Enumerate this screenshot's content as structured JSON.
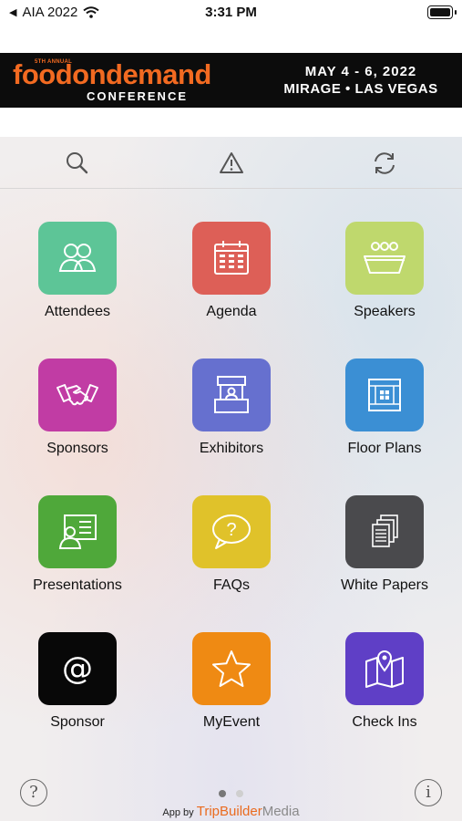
{
  "status_bar": {
    "carrier": "AIA 2022",
    "time": "3:31 PM",
    "back_glyph": "◀"
  },
  "banner": {
    "annual": "5TH ANNUAL",
    "title": "foodondemand",
    "subtitle": "CONFERENCE",
    "dates": "MAY 4 - 6, 2022",
    "location": "MIRAGE  •  LAS VEGAS",
    "accent": "#f26a21"
  },
  "toolbar": {
    "search_icon": "search-icon",
    "alert_icon": "alert-icon",
    "refresh_icon": "refresh-icon"
  },
  "tiles": [
    {
      "label": "Attendees",
      "color": "#5dc597",
      "icon": "attendees-icon"
    },
    {
      "label": "Agenda",
      "color": "#dd5f57",
      "icon": "calendar-icon"
    },
    {
      "label": "Speakers",
      "color": "#bfd86d",
      "icon": "speakers-icon"
    },
    {
      "label": "Sponsors",
      "color": "#c13ca4",
      "icon": "handshake-icon"
    },
    {
      "label": "Exhibitors",
      "color": "#6670cf",
      "icon": "booth-icon"
    },
    {
      "label": "Floor Plans",
      "color": "#3b8fd4",
      "icon": "floorplan-icon"
    },
    {
      "label": "Presentations",
      "color": "#4fa83a",
      "icon": "presentation-icon"
    },
    {
      "label": "FAQs",
      "color": "#e0c22a",
      "icon": "question-bubble-icon"
    },
    {
      "label": "White Papers",
      "color": "#4a4a4d",
      "icon": "documents-icon"
    },
    {
      "label": "Sponsor",
      "color": "#080808",
      "icon": "at-icon"
    },
    {
      "label": "MyEvent",
      "color": "#ef8a13",
      "icon": "star-icon"
    },
    {
      "label": "Check Ins",
      "color": "#5f3fc6",
      "icon": "map-pin-icon"
    }
  ],
  "bottom": {
    "help_label": "?",
    "info_label": "i",
    "page_index": 1,
    "page_count": 2
  },
  "footer": {
    "prefix": "App by",
    "brand_a": "TripBuilder",
    "brand_b": "Media"
  }
}
